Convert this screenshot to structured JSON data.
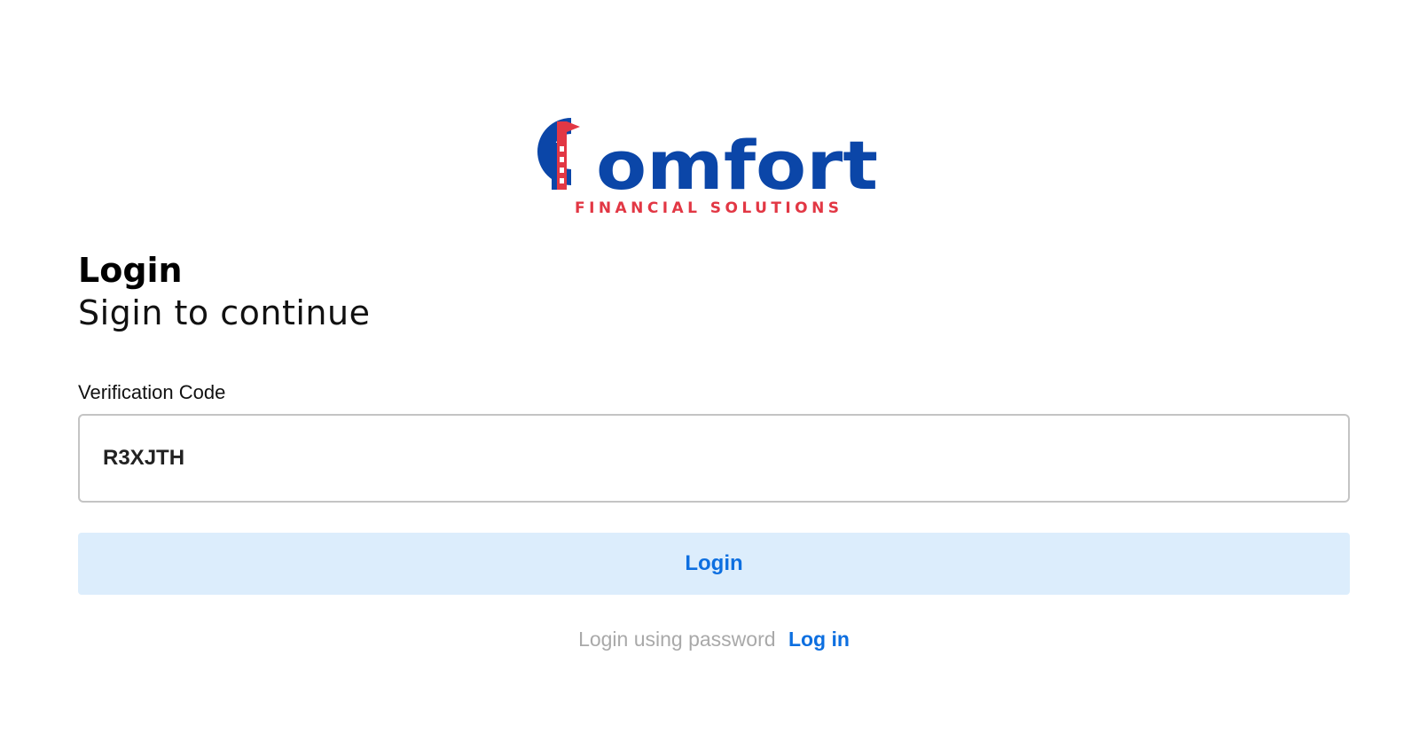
{
  "brand": {
    "name": "Comfort",
    "name_rest": "omfort",
    "tagline": "FINANCIAL SOLUTIONS",
    "primary_color": "#0b46a8",
    "accent_color": "#e23744",
    "logo_icon": "building-flag-icon"
  },
  "login": {
    "title": "Login",
    "subtitle": "Sigin to continue",
    "code_label": "Verification Code",
    "code_value": "R3XJTH",
    "submit_label": "Login",
    "alt_prompt": "Login using password",
    "alt_link": "Log in",
    "link_color": "#0d6fe0",
    "button_bg": "#dcedfc"
  }
}
